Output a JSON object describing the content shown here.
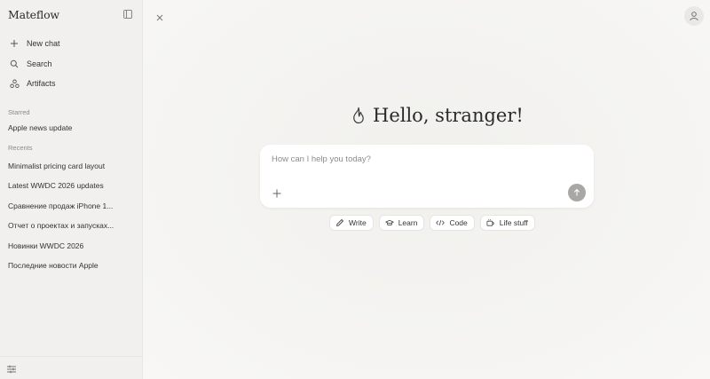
{
  "app": {
    "name": "Mateflow"
  },
  "sidebar": {
    "nav": [
      {
        "label": "New chat",
        "icon": "plus-icon"
      },
      {
        "label": "Search",
        "icon": "search-icon"
      },
      {
        "label": "Artifacts",
        "icon": "artifacts-icon"
      }
    ],
    "starred_label": "Starred",
    "starred": [
      "Apple news update"
    ],
    "recents_label": "Recents",
    "recents": [
      "Minimalist pricing card layout",
      "Latest WWDC 2026 updates",
      "Сравнение продаж iPhone 1...",
      "Отчет о проектах и запусках...",
      "Новинки WWDC 2026",
      "Последние новости Apple"
    ]
  },
  "main": {
    "greeting": "Hello, stranger!",
    "composer": {
      "placeholder": "How can I help you today?"
    },
    "chips": [
      {
        "label": "Write",
        "icon": "pencil-icon"
      },
      {
        "label": "Learn",
        "icon": "graduation-cap-icon"
      },
      {
        "label": "Code",
        "icon": "code-icon"
      },
      {
        "label": "Life stuff",
        "icon": "coffee-icon"
      }
    ]
  },
  "colors": {
    "sidebar_bg": "#f1f0ee",
    "main_bg": "#f4f3f1",
    "send_button": "#a9a7a4"
  }
}
